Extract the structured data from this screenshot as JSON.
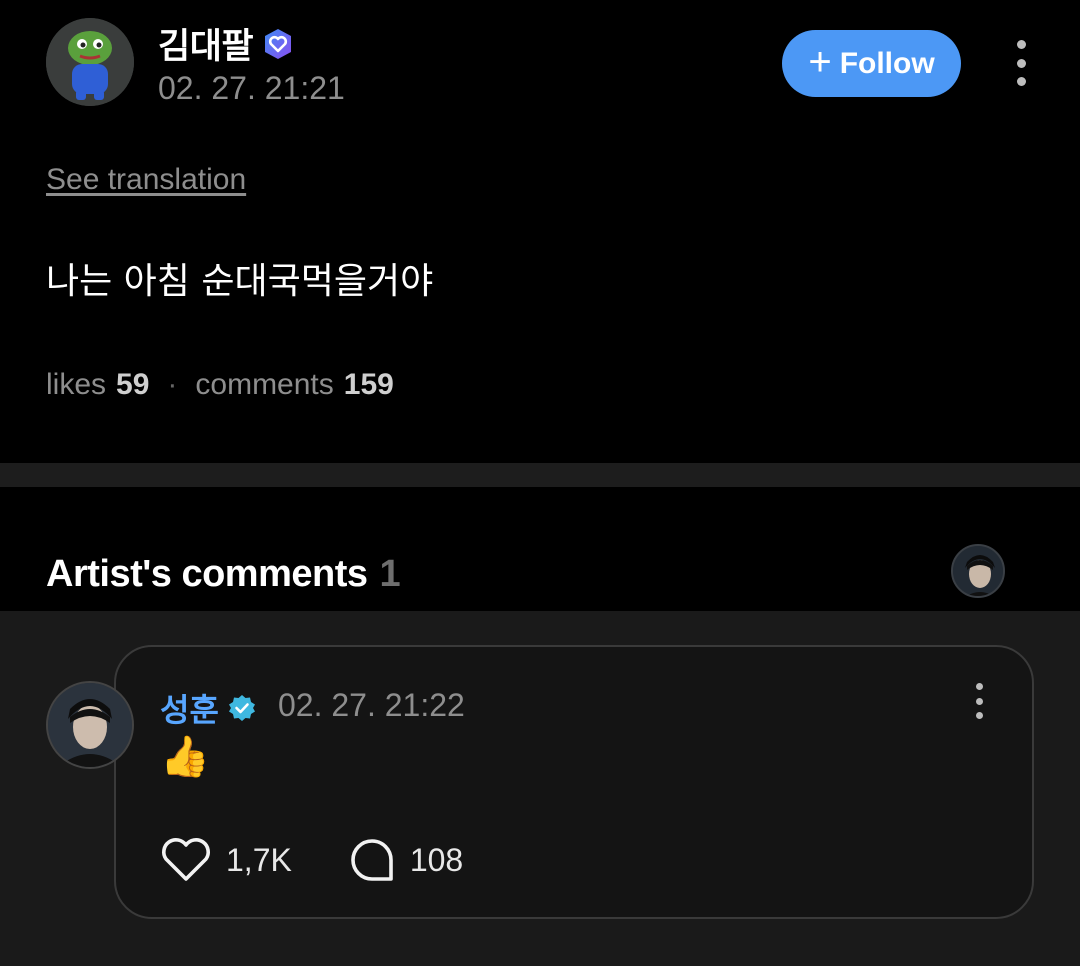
{
  "post": {
    "username": "김대팔",
    "timestamp": "02. 27. 21:21",
    "follow_label": "Follow",
    "see_translation": "See translation",
    "body": "나는 아침 순대국먹을거야",
    "likes_label": "likes",
    "likes_count": "59",
    "separator": "·",
    "comments_label": "comments",
    "comments_count": "159"
  },
  "artist_comments": {
    "title": "Artist's comments",
    "count": "1"
  },
  "comment": {
    "username": "성훈",
    "timestamp": "02. 27. 21:22",
    "body": "👍",
    "likes": "1,7K",
    "replies": "108"
  },
  "colors": {
    "follow_button": "#4c98f5",
    "artist_name": "#58a6ff",
    "verified_badge": "#3fb8e0",
    "creator_badge": "#6e5cf2"
  },
  "icons": {
    "follow": "plus-icon",
    "more": "more-vertical-icon",
    "like": "heart-outline-icon",
    "reply": "speech-bubble-icon",
    "verified": "verified-check-icon",
    "creator": "heart-shield-badge-icon"
  }
}
